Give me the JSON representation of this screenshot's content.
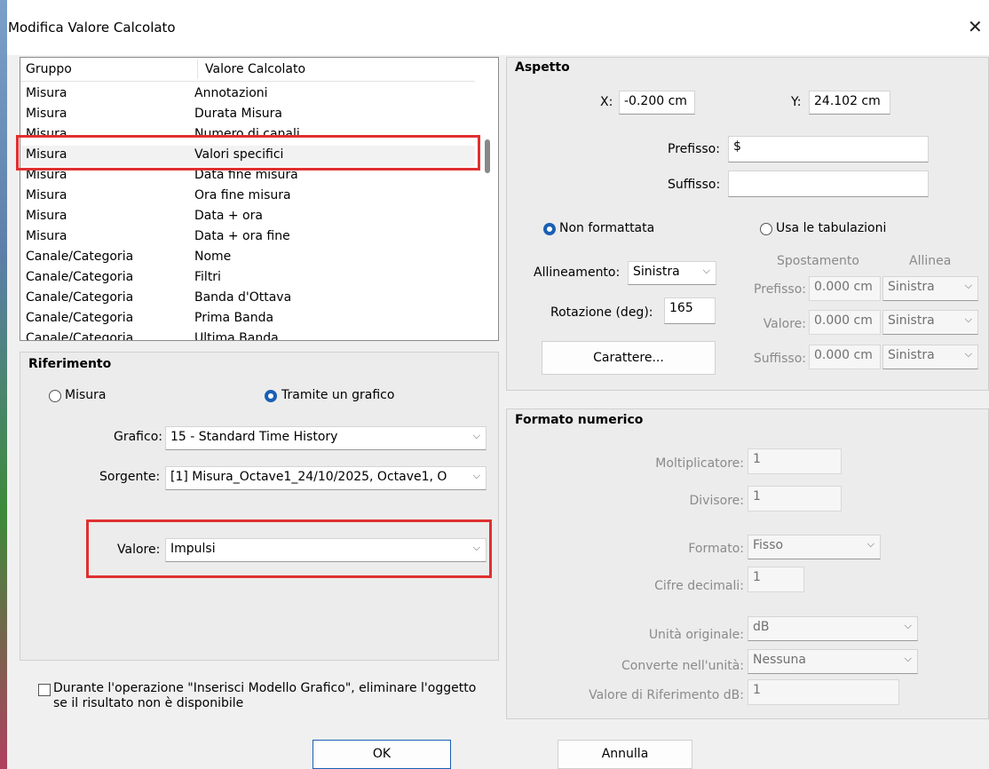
{
  "window": {
    "title": "Modifica Valore Calcolato",
    "close_glyph": "✕"
  },
  "list": {
    "headers": [
      "Gruppo",
      "Valore Calcolato"
    ],
    "rows": [
      [
        "Misura",
        "Annotazioni"
      ],
      [
        "Misura",
        "Durata Misura"
      ],
      [
        "Misura",
        "Numero di canali"
      ],
      [
        "Misura",
        "Valori specifici"
      ],
      [
        "Misura",
        "Data fine misura"
      ],
      [
        "Misura",
        "Ora fine misura"
      ],
      [
        "Misura",
        "Data + ora"
      ],
      [
        "Misura",
        "Data + ora fine"
      ],
      [
        "Canale/Categoria",
        "Nome"
      ],
      [
        "Canale/Categoria",
        "Filtri"
      ],
      [
        "Canale/Categoria",
        "Banda d'Ottava"
      ],
      [
        "Canale/Categoria",
        "Prima Banda"
      ],
      [
        "Canale/Categoria",
        "Ultima Banda"
      ]
    ]
  },
  "riferimento": {
    "title": "Riferimento",
    "radio_misura": "Misura",
    "radio_grafico": "Tramite un grafico",
    "grafico_label": "Grafico:",
    "grafico_value": "15 - Standard Time History",
    "sorgente_label": "Sorgente:",
    "sorgente_value": "[1] Misura_Octave1_24/10/2025, Octave1, O",
    "valore_label": "Valore:",
    "valore_value": "Impulsi"
  },
  "checkbox_text": "Durante l'operazione \"Inserisci Modello Grafico\", eliminare l'oggetto se il risultato non è disponibile",
  "aspetto": {
    "title": "Aspetto",
    "x_label": "X:",
    "x_value": "-0.200 cm",
    "y_label": "Y:",
    "y_value": "24.102 cm",
    "prefisso_label": "Prefisso:",
    "prefisso_value": "$",
    "suffisso_label": "Suffisso:",
    "suffisso_value": "",
    "radio_nonformattata": "Non formattata",
    "radio_tabulazioni": "Usa le tabulazioni",
    "allineamento_label": "Allineamento:",
    "allineamento_value": "Sinistra",
    "rotazione_label": "Rotazione (deg):",
    "rotazione_value": "165",
    "carattere_button": "Carattere...",
    "col_spostamento": "Spostamento",
    "col_allinea": "Allinea",
    "tab_rows": [
      {
        "label": "Prefisso:",
        "offset": "0.000 cm",
        "align": "Sinistra"
      },
      {
        "label": "Valore:",
        "offset": "0.000 cm",
        "align": "Sinistra"
      },
      {
        "label": "Suffisso:",
        "offset": "0.000 cm",
        "align": "Sinistra"
      }
    ]
  },
  "formato": {
    "title": "Formato numerico",
    "moltiplicatore_label": "Moltiplicatore:",
    "moltiplicatore_value": "1",
    "divisore_label": "Divisore:",
    "divisore_value": "1",
    "formato_label": "Formato:",
    "formato_value": "Fisso",
    "cifre_label": "Cifre decimali:",
    "cifre_value": "1",
    "unita_label": "Unità originale:",
    "unita_value": "dB",
    "converte_label": "Converte nell'unità:",
    "converte_value": "Nessuna",
    "riferimento_label": "Valore di Riferimento dB:",
    "riferimento_value": "1"
  },
  "buttons": {
    "ok": "OK",
    "annulla": "Annulla"
  },
  "colors": {
    "highlight_box": "#e03030",
    "radio_accent": "#1a5fb4"
  }
}
